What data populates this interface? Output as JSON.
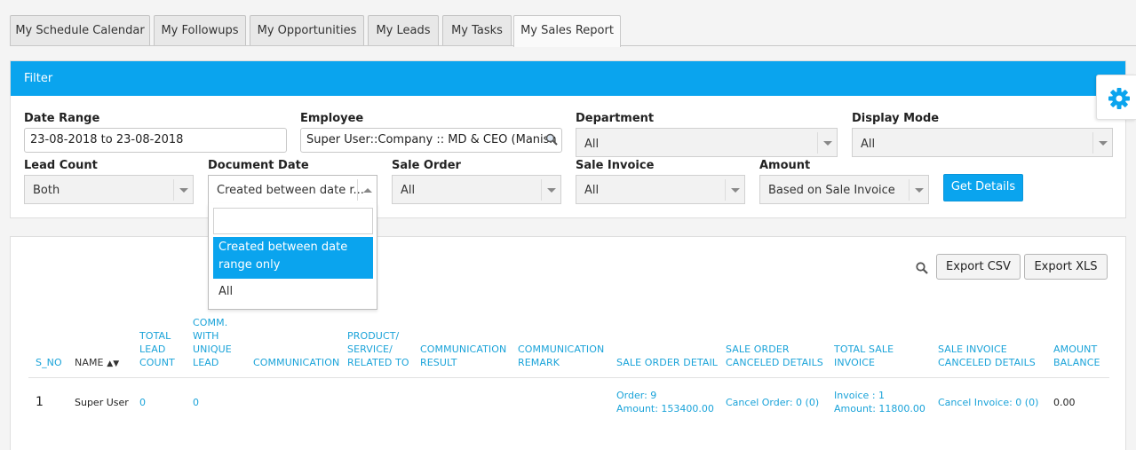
{
  "tabs": [
    "My Schedule Calendar",
    "My Followups",
    "My Opportunities",
    "My Leads",
    "My Tasks",
    "My Sales Report"
  ],
  "active_tab": "My Sales Report",
  "filter": {
    "title": "Filter",
    "date_range": {
      "label": "Date Range",
      "value": "23-08-2018 to 23-08-2018"
    },
    "employee": {
      "label": "Employee",
      "value": "Super User::Company :: MD & CEO (Manish K"
    },
    "department": {
      "label": "Department",
      "value": "All"
    },
    "display_mode": {
      "label": "Display Mode",
      "value": "All"
    },
    "lead_count": {
      "label": "Lead Count",
      "value": "Both"
    },
    "document_date": {
      "label": "Document Date",
      "value": "Created between date r...",
      "options": [
        "Created between date range only",
        "All"
      ],
      "highlighted_option": "Created between date range only",
      "search_value": ""
    },
    "sale_order": {
      "label": "Sale Order",
      "value": "All"
    },
    "sale_invoice": {
      "label": "Sale Invoice",
      "value": "All"
    },
    "amount": {
      "label": "Amount",
      "value": "Based on Sale Invoice"
    },
    "get_details_label": "Get Details"
  },
  "report": {
    "export_csv_label": "Export CSV",
    "export_xls_label": "Export XLS",
    "columns": {
      "s_no": "S_NO",
      "name": "NAME",
      "total_lead_count": [
        "TOTAL",
        "LEAD",
        "COUNT"
      ],
      "comm_unique_lead": [
        "COMM.",
        "WITH",
        "UNIQUE",
        "LEAD"
      ],
      "communication": "COMMUNICATION",
      "product": [
        "PRODUCT/",
        "SERVICE/",
        "RELATED TO"
      ],
      "communication_result": [
        "COMMUNICATION",
        "RESULT"
      ],
      "communication_remark": [
        "COMMUNICATION",
        "REMARK"
      ],
      "sale_order_detail": "SALE ORDER DETAIL",
      "sale_order_canceled": [
        "SALE ORDER",
        "CANCELED DETAILS"
      ],
      "total_sale_invoice": [
        "TOTAL SALE",
        "INVOICE"
      ],
      "sale_invoice_canceled": [
        "SALE INVOICE",
        "CANCELED DETAILS"
      ],
      "amount_balance": [
        "AMOUNT",
        "BALANCE"
      ]
    },
    "rows": [
      {
        "s_no": "1",
        "name": "Super User",
        "total_lead_count": "0",
        "comm_unique_lead": "0",
        "sale_order_detail": [
          "Order: 9",
          "Amount: 153400.00"
        ],
        "sale_order_canceled": "Cancel Order: 0 (0)",
        "total_sale_invoice": [
          "Invoice : 1",
          "Amount: 11800.00"
        ],
        "sale_invoice_canceled": "Cancel Invoice: 0 (0)",
        "amount_balance": "0.00"
      }
    ]
  },
  "colors": {
    "accent": "#0aa4ee",
    "link": "#1aa3d9"
  }
}
